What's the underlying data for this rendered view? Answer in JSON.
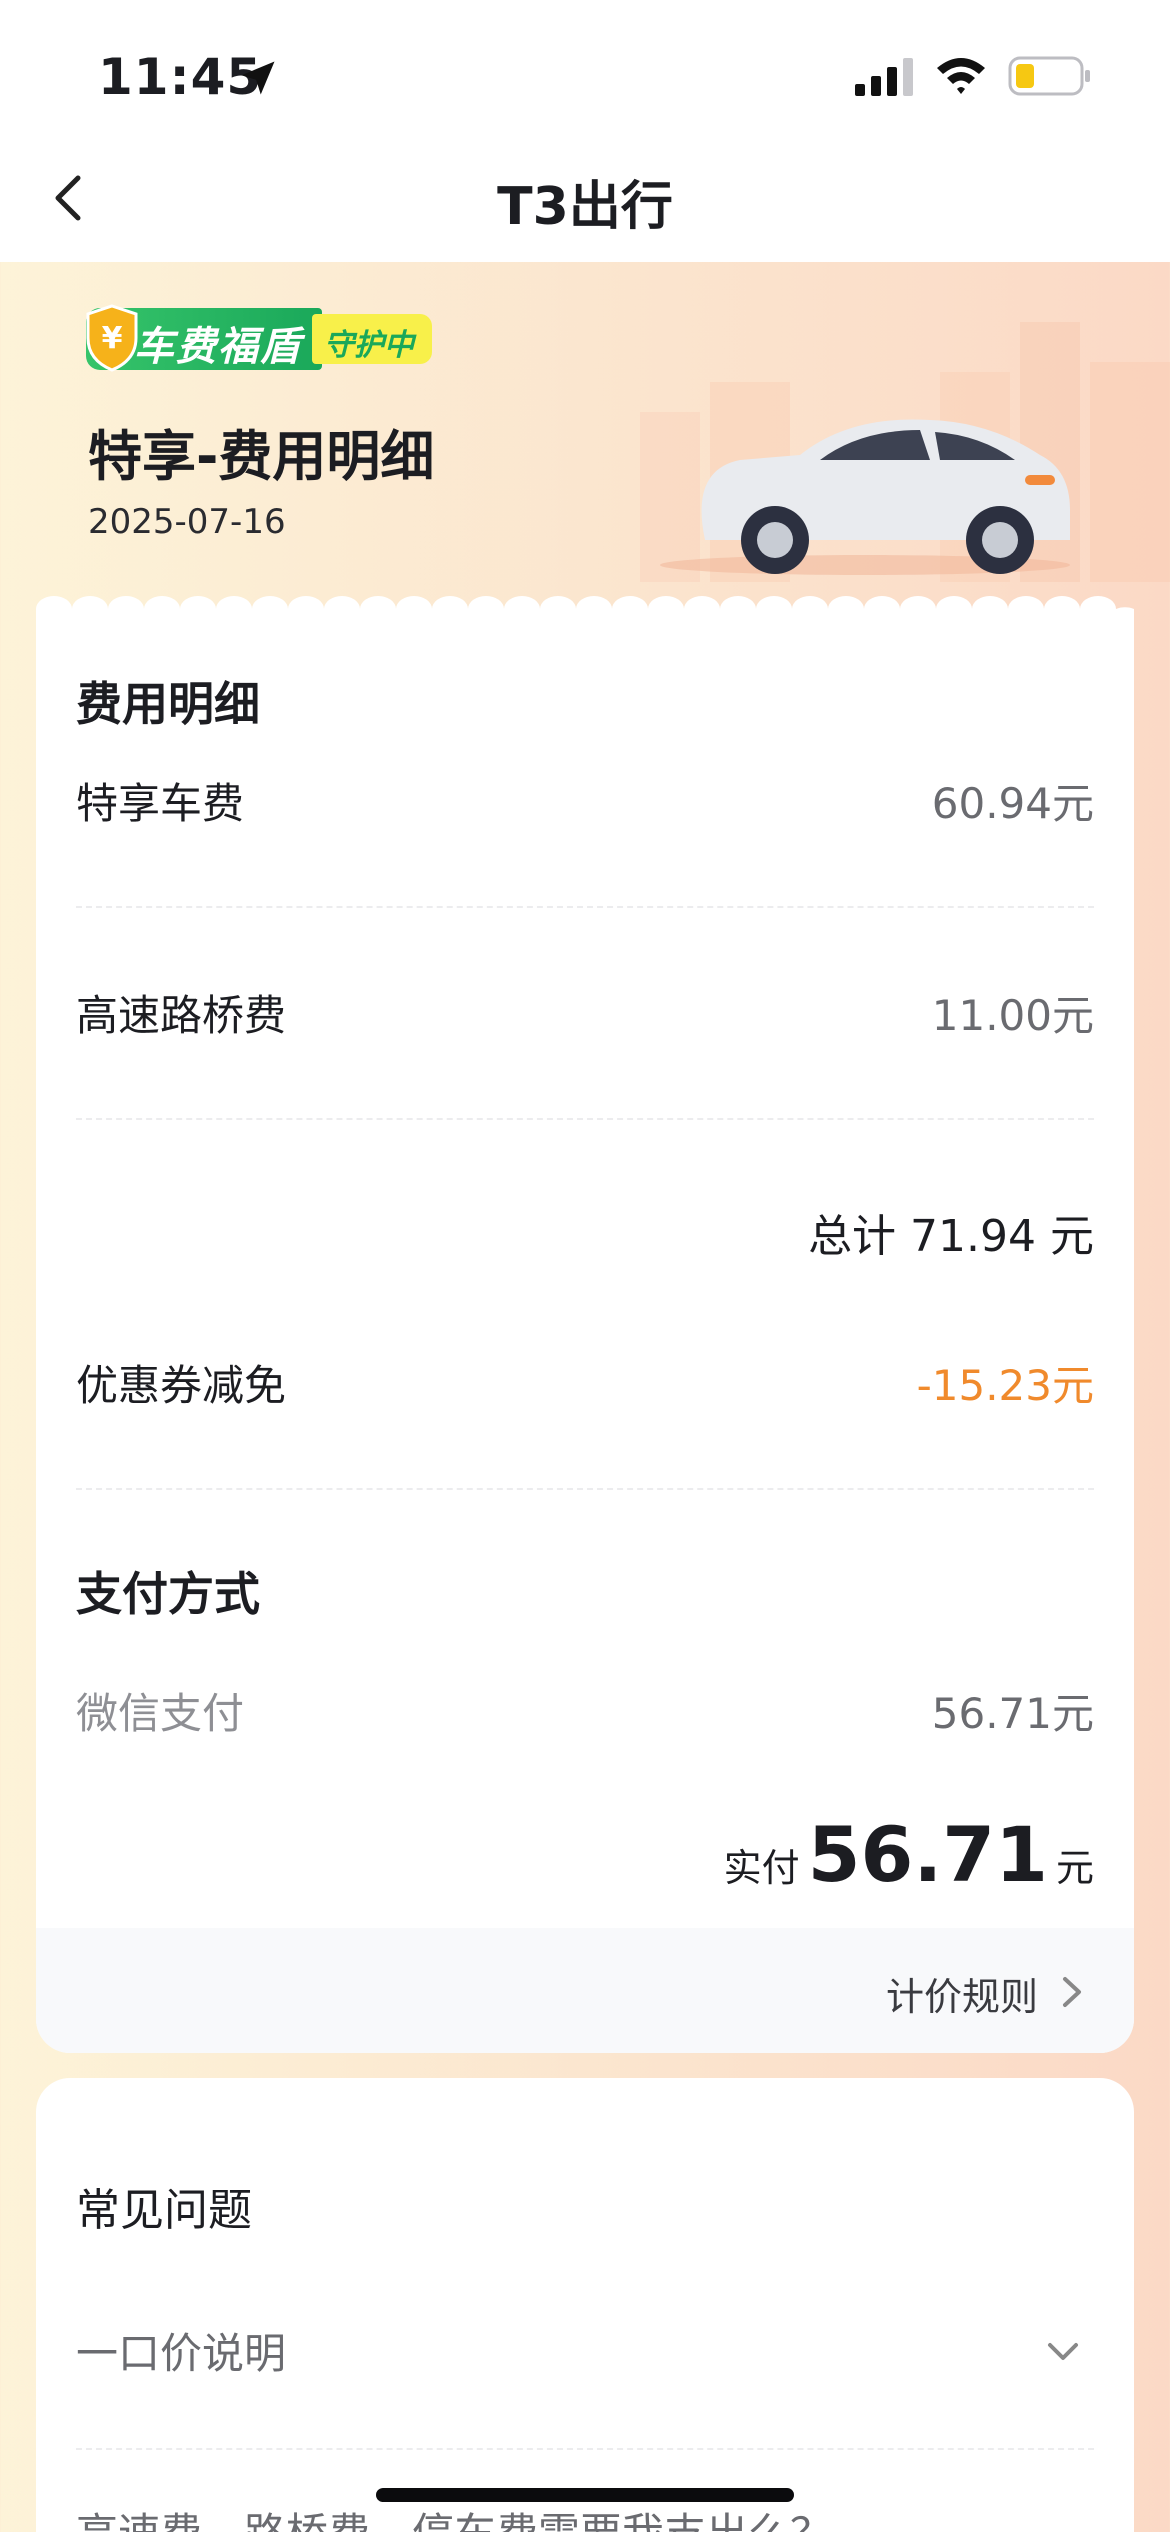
{
  "status_bar": {
    "time": "11:45"
  },
  "nav": {
    "title": "T3出行"
  },
  "banner": {
    "badge_text": "车费福盾",
    "badge_sub": "守护中",
    "title": "特享-费用明细",
    "date": "2025-07-16"
  },
  "fee_details": {
    "section_title": "费用明细",
    "items": [
      {
        "label": "特享车费",
        "value": "60.94元"
      },
      {
        "label": "高速路桥费",
        "value": "11.00元"
      }
    ],
    "total": "总计 71.94 元",
    "discount": {
      "label": "优惠券减免",
      "value": "-15.23元"
    }
  },
  "payment": {
    "section_title": "支付方式",
    "method": {
      "label": "微信支付",
      "value": "56.71元"
    },
    "paid_label": "实付",
    "paid_amount": "56.71",
    "paid_unit": "元",
    "pricing_rules": "计价规则"
  },
  "faq": {
    "title": "常见问题",
    "items": [
      "一口价说明",
      "高速费、路桥费、停车费需要我支出么？"
    ]
  },
  "colors": {
    "accent_orange": "#f08a2c",
    "badge_green": "#1aa85a",
    "badge_yellow": "#f8f04a"
  }
}
